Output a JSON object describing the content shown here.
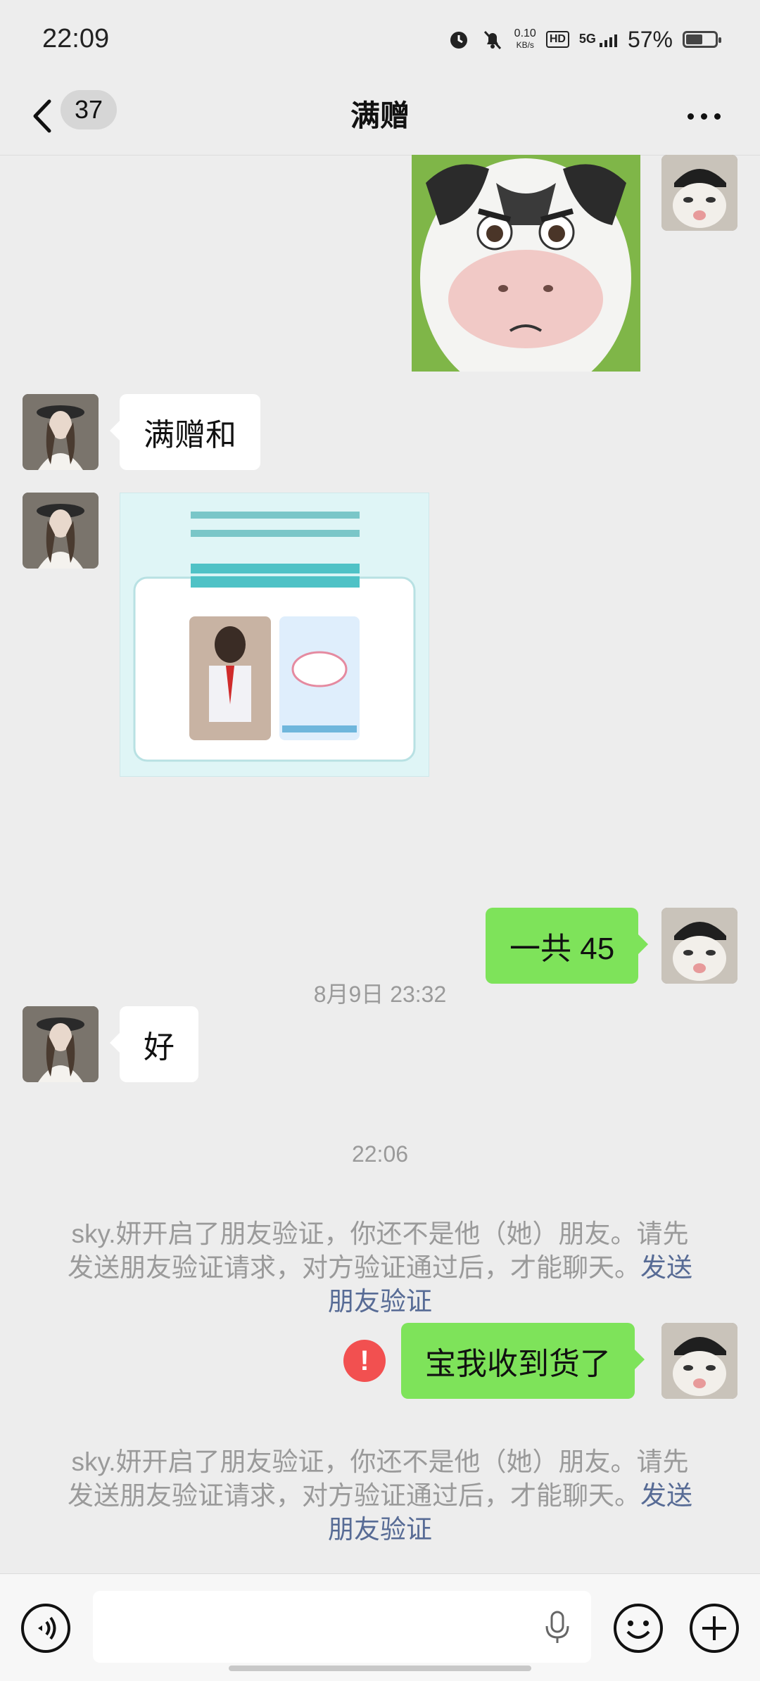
{
  "status_bar": {
    "time": "22:09",
    "net_speed_value": "0.10",
    "net_speed_unit": "KB/s",
    "hd_label": "HD",
    "signal_label": "5G",
    "battery_text": "57%",
    "battery_level": 0.57
  },
  "header": {
    "unread_count": "37",
    "title": "满赠"
  },
  "messages": {
    "m1_text": "满赠和",
    "ts1": "8月9日 23:32",
    "m2_text": "一共 45",
    "m3_text": "好",
    "ts2": "22:06",
    "sys1_text": "sky.妍开启了朋友验证，你还不是他（她）朋友。请先发送朋友验证请求，对方验证通过后，才能聊天。",
    "sys1_link": "发送朋友验证",
    "m4_text": "宝我收到货了",
    "m4_error_icon": "!",
    "sys2_text": "sky.妍开启了朋友验证，你还不是他（她）朋友。请先发送朋友验证请求，对方验证通过后，才能聊天。",
    "sys2_link": "发送朋友验证"
  },
  "input_bar": {
    "placeholder": ""
  },
  "colors": {
    "background": "#ededed",
    "bubble_self": "#7ee35a",
    "bubble_other": "#ffffff",
    "link": "#576b95",
    "error": "#f25050"
  }
}
